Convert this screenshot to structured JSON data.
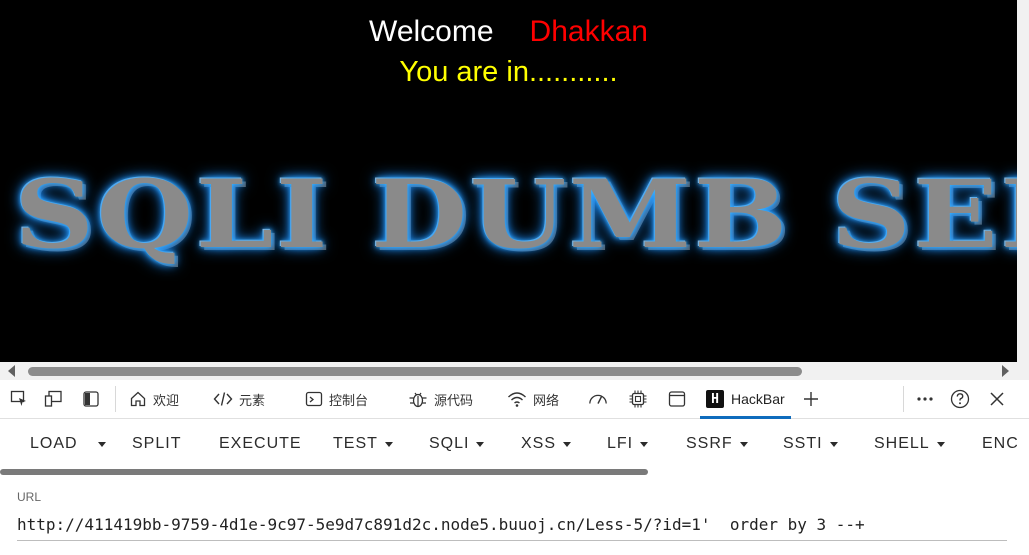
{
  "page": {
    "welcome": "Welcome",
    "username": "Dhakkan",
    "status": "You are in...........",
    "banner": "SQLI DUMB SERIES"
  },
  "devtools": {
    "tabs": [
      {
        "label": "欢迎",
        "icon": "home-icon"
      },
      {
        "label": "元素",
        "icon": "code-tags-icon"
      },
      {
        "label": "控制台",
        "icon": "console-icon"
      },
      {
        "label": "源代码",
        "icon": "bug-icon"
      },
      {
        "label": "网络",
        "icon": "wifi-icon"
      }
    ],
    "active_tab": "HackBar",
    "hackbar_logo": "H"
  },
  "hackbar": {
    "menu": [
      {
        "label": "LOAD"
      },
      {
        "label": "SPLIT"
      },
      {
        "label": "EXECUTE"
      },
      {
        "label": "TEST"
      },
      {
        "label": "SQLI"
      },
      {
        "label": "XSS"
      },
      {
        "label": "LFI"
      },
      {
        "label": "SSRF"
      },
      {
        "label": "SSTI"
      },
      {
        "label": "SHELL"
      },
      {
        "label": "ENC"
      }
    ],
    "url_label": "URL",
    "url_value": "http://411419bb-9759-4d1e-9c97-5e9d7c891d2c.node5.buuoj.cn/Less-5/?id=1'  order by 3 --+"
  },
  "colors": {
    "welcome": "#ffffff",
    "username": "#ff0000",
    "status": "#ffff00",
    "accent": "#0f6cbd",
    "banner_glow": "#1e90ff"
  }
}
